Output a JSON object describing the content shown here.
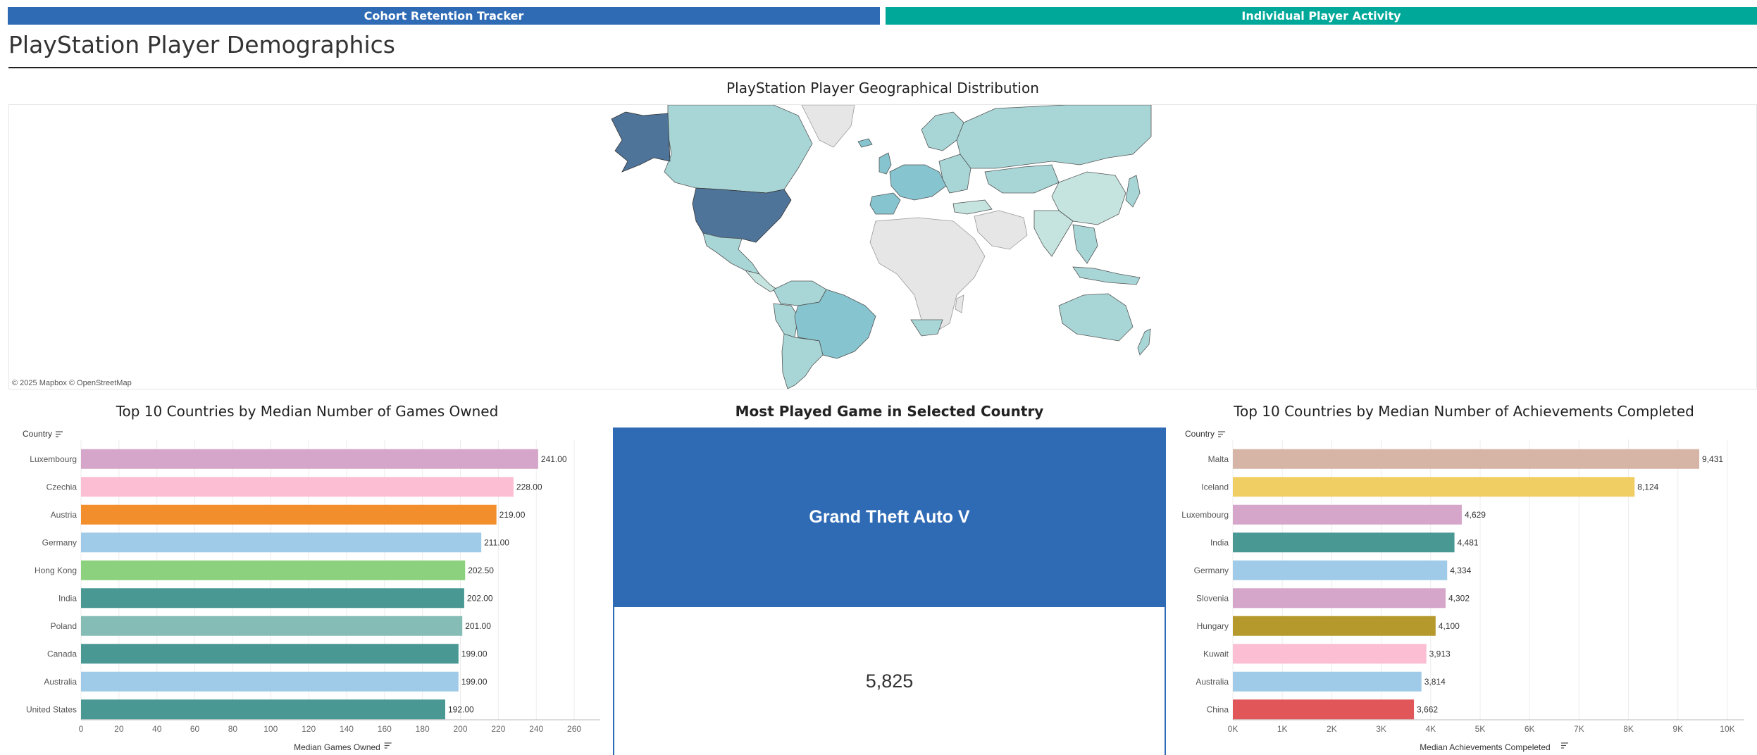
{
  "nav": {
    "cohort_label": "Cohort Retention Tracker",
    "player_label": "Individual Player Activity"
  },
  "dashboard_title": "PlayStation Player Demographics",
  "map": {
    "title": "PlayStation Player Geographical Distribution",
    "credit": "© 2025 Mapbox © OpenStreetMap",
    "colors": {
      "highest": "#4f7499",
      "high": "#86c4cf",
      "mid": "#a8d6d7",
      "low": "#c5e4df",
      "nodata": "#e6e6e6"
    }
  },
  "most_played": {
    "title": "Most Played Game in Selected Country",
    "game": "Grand Theft Auto V",
    "value": "5,825"
  },
  "chart_data": [
    {
      "type": "bar",
      "orientation": "horizontal",
      "title": "Top 10 Countries by Median Number of Games Owned",
      "xlabel": "Median Games Owned",
      "ylabel": "Country",
      "xlim": [
        0,
        270
      ],
      "xticks": [
        0,
        20,
        40,
        60,
        80,
        100,
        120,
        140,
        160,
        180,
        200,
        220,
        240,
        260
      ],
      "xtick_labels": [
        "0",
        "20",
        "40",
        "60",
        "80",
        "100",
        "120",
        "140",
        "160",
        "180",
        "200",
        "220",
        "240",
        "260"
      ],
      "categories": [
        "Luxembourg",
        "Czechia",
        "Austria",
        "Germany",
        "Hong Kong",
        "India",
        "Poland",
        "Canada",
        "Australia",
        "United States"
      ],
      "values": [
        241,
        228,
        219,
        211,
        202.5,
        202,
        201,
        199,
        199,
        192
      ],
      "labels": [
        "241.00",
        "228.00",
        "219.00",
        "211.00",
        "202.50",
        "202.00",
        "201.00",
        "199.00",
        "199.00",
        "192.00"
      ],
      "colors": [
        "#d5a6c9",
        "#fbbed3",
        "#f28e2b",
        "#a0cbe8",
        "#8cd17d",
        "#499894",
        "#86bcb6",
        "#499894",
        "#a0cbe8",
        "#499894"
      ],
      "grid": true
    },
    {
      "type": "bar",
      "orientation": "horizontal",
      "title": "Top 10 Countries by Median Number of Achievements Completed",
      "xlabel": "Median Achievements Compeleted",
      "ylabel": "Country",
      "xlim": [
        0,
        10200
      ],
      "xticks": [
        0,
        1000,
        2000,
        3000,
        4000,
        5000,
        6000,
        7000,
        8000,
        9000,
        10000
      ],
      "xtick_labels": [
        "0K",
        "1K",
        "2K",
        "3K",
        "4K",
        "5K",
        "6K",
        "7K",
        "8K",
        "9K",
        "10K"
      ],
      "categories": [
        "Malta",
        "Iceland",
        "Luxembourg",
        "India",
        "Germany",
        "Slovenia",
        "Hungary",
        "Kuwait",
        "Australia",
        "China"
      ],
      "values": [
        9431,
        8124,
        4629,
        4481,
        4334,
        4302,
        4100,
        3913,
        3814,
        3662
      ],
      "labels": [
        "9,431",
        "8,124",
        "4,629",
        "4,481",
        "4,334",
        "4,302",
        "4,100",
        "3,913",
        "3,814",
        "3,662"
      ],
      "colors": [
        "#d7b5a6",
        "#f1ce63",
        "#d5a6c9",
        "#499894",
        "#a0cbe8",
        "#d5a6c9",
        "#b6992d",
        "#fbbed3",
        "#a0cbe8",
        "#e15759"
      ],
      "grid": true
    }
  ]
}
